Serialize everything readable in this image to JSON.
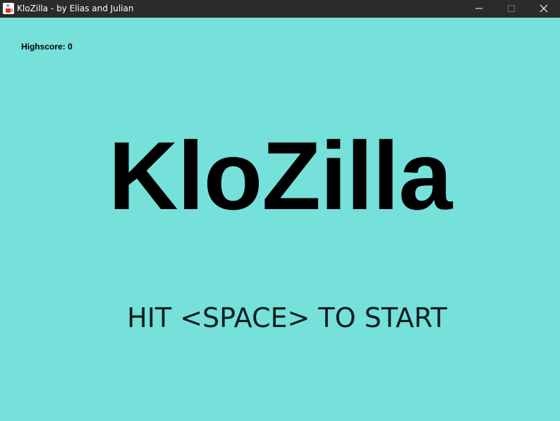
{
  "window": {
    "title": "KloZilla - by Elias and Julian",
    "icon": "java-coffee-cup-icon",
    "controls": [
      "minimize-icon",
      "maximize-icon",
      "close-icon"
    ]
  },
  "hud": {
    "highscore_label": "Highscore:",
    "highscore_value": "0"
  },
  "screen": {
    "title": "KloZilla",
    "prompt": "HIT <SPACE> TO START"
  },
  "colors": {
    "background": "#76e0db",
    "titlebar": "#2b2b2b",
    "text": "#000000"
  }
}
